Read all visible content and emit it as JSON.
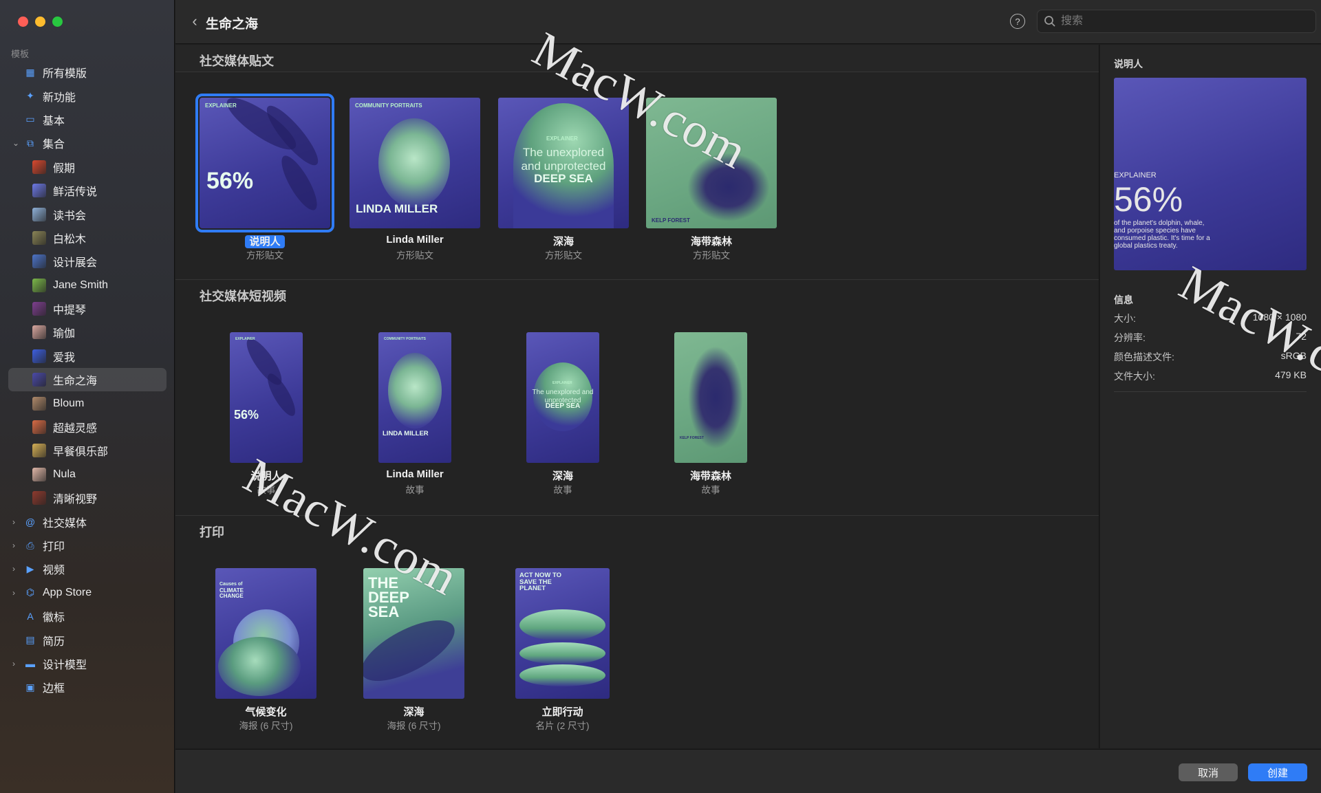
{
  "sidebar": {
    "section_label": "模板",
    "items": [
      {
        "label": "所有模版",
        "icon": "grid-icon",
        "level": 0,
        "chevron": ""
      },
      {
        "label": "新功能",
        "icon": "sparkle-icon",
        "level": 0,
        "chevron": ""
      },
      {
        "label": "基本",
        "icon": "rectangle-icon",
        "level": 0,
        "chevron": ""
      },
      {
        "label": "集合",
        "icon": "collection-icon",
        "level": 0,
        "chevron": "⌄"
      },
      {
        "label": "假期",
        "icon": "holiday-thumb-icon",
        "level": 1,
        "color": "#d9492f"
      },
      {
        "label": "鲜活传说",
        "icon": "legend-thumb-icon",
        "level": 1,
        "color": "#6d79e6"
      },
      {
        "label": "读书会",
        "icon": "bookclub-thumb-icon",
        "level": 1,
        "color": "#8fb1d8"
      },
      {
        "label": "白松木",
        "icon": "pine-thumb-icon",
        "level": 1,
        "color": "#8a8456"
      },
      {
        "label": "设计展会",
        "icon": "design-fair-thumb-icon",
        "level": 1,
        "color": "#4d74c9"
      },
      {
        "label": "Jane Smith",
        "icon": "jane-smith-thumb-icon",
        "level": 1,
        "color": "#7cb84a"
      },
      {
        "label": "中提琴",
        "icon": "viola-thumb-icon",
        "level": 1,
        "color": "#7e3f8f"
      },
      {
        "label": "瑜伽",
        "icon": "yoga-thumb-icon",
        "level": 1,
        "color": "#d8a7a0"
      },
      {
        "label": "爱我",
        "icon": "love-me-thumb-icon",
        "level": 1,
        "color": "#3d5fe0"
      },
      {
        "label": "生命之海",
        "icon": "sea-of-life-thumb-icon",
        "level": 1,
        "color": "#4b4aa8",
        "selected": true
      },
      {
        "label": "Bloum",
        "icon": "bloum-thumb-icon",
        "level": 1,
        "color": "#b08a6b"
      },
      {
        "label": "超越灵感",
        "icon": "inspiration-thumb-icon",
        "level": 1,
        "color": "#d96b45"
      },
      {
        "label": "早餐俱乐部",
        "icon": "breakfast-thumb-icon",
        "level": 1,
        "color": "#d6b056"
      },
      {
        "label": "Nula",
        "icon": "nula-thumb-icon",
        "level": 1,
        "color": "#e0b7a8"
      },
      {
        "label": "清晰视野",
        "icon": "clear-view-thumb-icon",
        "level": 1,
        "color": "#8f3a2e"
      },
      {
        "label": "社交媒体",
        "icon": "at-sign-icon",
        "level": 0,
        "chevron": "›"
      },
      {
        "label": "打印",
        "icon": "printer-icon",
        "level": 0,
        "chevron": "›"
      },
      {
        "label": "视频",
        "icon": "video-icon",
        "level": 0,
        "chevron": "›"
      },
      {
        "label": "App Store",
        "icon": "app-store-icon",
        "level": 0,
        "chevron": "›"
      },
      {
        "label": "徽标",
        "icon": "logo-a-icon",
        "level": 0,
        "chevron": ""
      },
      {
        "label": "简历",
        "icon": "resume-icon",
        "level": 0,
        "chevron": ""
      },
      {
        "label": "设计模型",
        "icon": "mockup-icon",
        "level": 0,
        "chevron": "›"
      },
      {
        "label": "边框",
        "icon": "frame-icon",
        "level": 0,
        "chevron": ""
      }
    ]
  },
  "toolbar": {
    "title": "生命之海",
    "search_placeholder": "搜索"
  },
  "sections": [
    {
      "title": "社交媒体贴文",
      "cards": [
        {
          "name": "说明人",
          "sub": "方形贴文",
          "selected": true,
          "big": "56%",
          "small": "EXPLAINER"
        },
        {
          "name": "Linda Miller",
          "sub": "方形贴文",
          "big": "LINDA MILLER",
          "small": "COMMUNITY PORTRAITS"
        },
        {
          "name": "深海",
          "sub": "方形贴文",
          "big": "DEEP SEA",
          "small": "EXPLAINER",
          "line": "The unexplored and unprotected"
        },
        {
          "name": "海带森林",
          "sub": "方形贴文",
          "small": "KELP FOREST"
        }
      ]
    },
    {
      "title": "社交媒体短视频",
      "cards": [
        {
          "name": "说明人",
          "sub": "故事",
          "big": "56%",
          "small": "EXPLAINER"
        },
        {
          "name": "Linda Miller",
          "sub": "故事",
          "big": "LINDA MILLER",
          "small": "COMMUNITY PORTRAITS"
        },
        {
          "name": "深海",
          "sub": "故事",
          "big": "DEEP SEA",
          "small": "EXPLAINER",
          "line": "The unexplored and unprotected"
        },
        {
          "name": "海带森林",
          "sub": "故事",
          "small": "KELP FOREST"
        }
      ]
    },
    {
      "title": "打印",
      "cards": [
        {
          "name": "气候变化",
          "sub": "海报 (6 尺寸)",
          "big": "CLIMATE CHANGE",
          "small": "Causes of"
        },
        {
          "name": "深海",
          "sub": "海报 (6 尺寸)",
          "big": "THE DEEP SEA"
        },
        {
          "name": "立即行动",
          "sub": "名片 (2 尺寸)",
          "big": "ACT NOW TO SAVE THE PLANET"
        }
      ]
    }
  ],
  "inspector": {
    "title": "说明人",
    "preview": {
      "small": "EXPLAINER",
      "big": "56%",
      "body": "of the planet's dolphin, whale, and porpoise species have consumed plastic. It's time for a global plastics treaty."
    },
    "info_title": "信息",
    "rows": [
      {
        "key": "大小:",
        "value": "1080 × 1080"
      },
      {
        "key": "分辨率:",
        "value": "72"
      },
      {
        "key": "颜色描述文件:",
        "value": "sRGB"
      },
      {
        "key": "文件大小:",
        "value": "479 KB"
      }
    ]
  },
  "footer": {
    "cancel": "取消",
    "create": "创建"
  },
  "watermark": "MacW.com",
  "colors": {
    "accent": "#2f7cf6",
    "thumb_purple": "#3d3a98",
    "thumb_green": "#6aa681"
  }
}
